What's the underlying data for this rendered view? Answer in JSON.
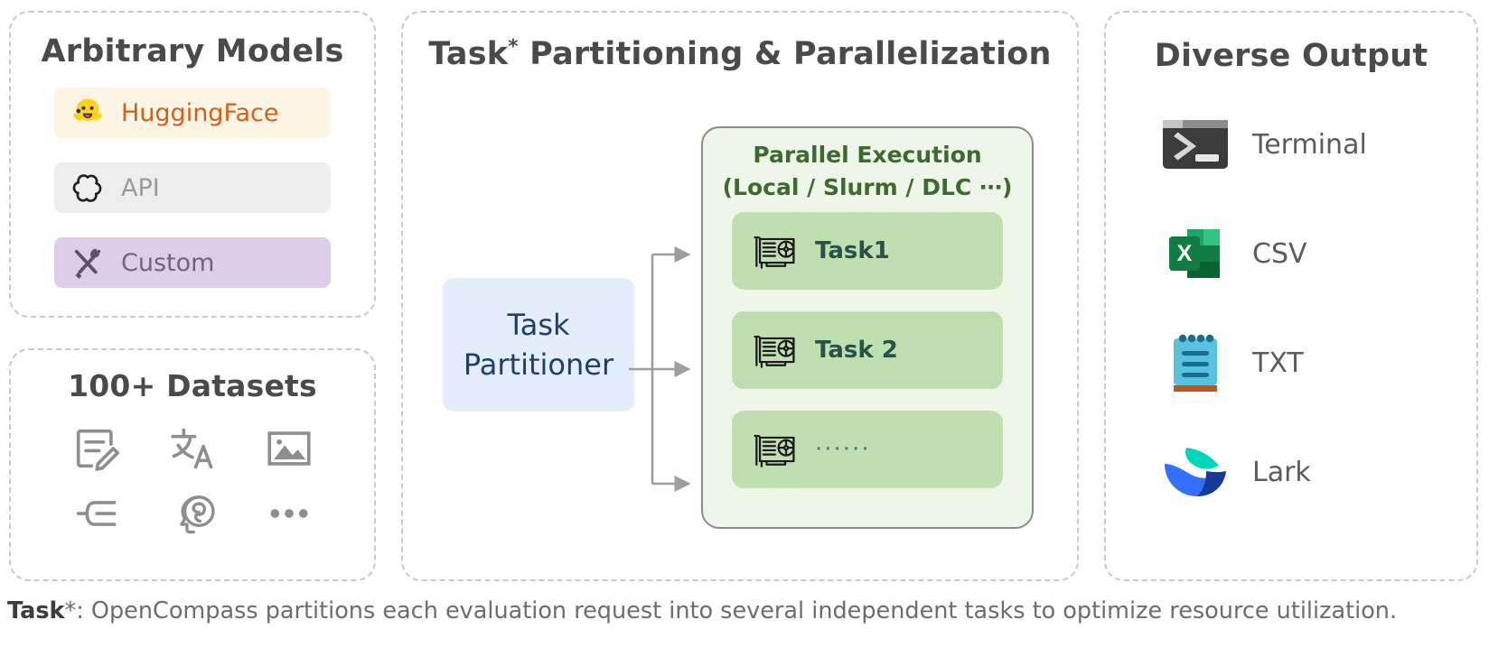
{
  "models_panel": {
    "title": "Arbitrary Models",
    "rows": [
      {
        "label": "HuggingFace",
        "icon": "huggingface-icon",
        "bg": "#fdf5e3",
        "fg": "#d2601a"
      },
      {
        "label": "API",
        "icon": "openai-icon",
        "bg": "#eeeeee",
        "fg": "#9a9a9a"
      },
      {
        "label": "Custom",
        "icon": "tools-icon",
        "bg": "#ddcdeb",
        "fg": "#6f6480"
      }
    ]
  },
  "datasets_panel": {
    "title": "100+ Datasets",
    "icons": [
      "document-edit-icon",
      "translate-icon",
      "image-icon",
      "logic-list-icon",
      "brain-head-icon",
      "ellipsis-icon"
    ]
  },
  "center_panel": {
    "title_main": "Task",
    "title_star": "*",
    "title_rest": " Partitioning & Parallelization",
    "partitioner": {
      "line1": "Task",
      "line2": "Partitioner"
    },
    "execution": {
      "title_line1": "Parallel Execution",
      "title_line2": "(Local / Slurm / DLC ⋯)",
      "tasks": [
        {
          "label": "Task1",
          "icon": "gpu-card-icon"
        },
        {
          "label": "Task 2",
          "icon": "gpu-card-icon"
        },
        {
          "label": "······",
          "icon": "gpu-card-icon"
        }
      ]
    }
  },
  "output_panel": {
    "title": "Diverse Output",
    "rows": [
      {
        "label": "Terminal",
        "icon": "terminal-icon"
      },
      {
        "label": "CSV",
        "icon": "excel-csv-icon"
      },
      {
        "label": "TXT",
        "icon": "notepad-txt-icon"
      },
      {
        "label": "Lark",
        "icon": "lark-icon"
      }
    ]
  },
  "footnote": {
    "bold": "Task",
    "rest": "*: OpenCompass partitions each evaluation request into several independent tasks to optimize resource utilization."
  },
  "colors": {
    "panel_border": "#c9c9c9",
    "title_gray": "#4a4a4a",
    "green_dark": "#3d6b2e",
    "green_box": "#eef6e9",
    "task_green": "#bfdfb0",
    "blue_box": "#e4eefa",
    "blue_text": "#1f3f6b",
    "connector_gray": "#9e9e9e"
  }
}
